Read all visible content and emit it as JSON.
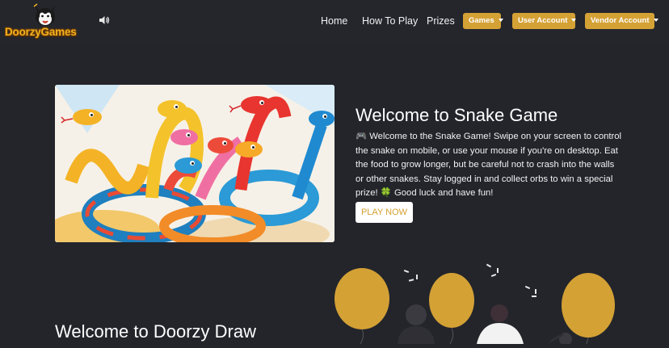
{
  "header": {
    "logo_text": "DoorzyGames",
    "nav": {
      "home": "Home",
      "how_to_play": "How To Play",
      "prizes": "Prizes"
    },
    "dropdowns": {
      "games": "Games",
      "user_account": "User Account",
      "vendor_account": "Vendor Account"
    },
    "icons": {
      "logo": "cat-mascot-icon",
      "sound": "speaker-icon",
      "caret": "caret-down-icon"
    }
  },
  "hero": {
    "image_alt": "snakes-illustration",
    "title": "Welcome to Snake Game",
    "description": "🎮 Welcome to the Snake Game! Swipe on your screen to control the snake on mobile, or use your mouse if you're on desktop. Eat the food to grow longer, but be careful not to crash into the walls or other snakes. Stay logged in and collect orbs to win a special prize! 🍀 Good luck and have fun!",
    "play_button": "PLAY NOW"
  },
  "section2": {
    "title": "Welcome to Doorzy Draw",
    "image_alt": "party-balloons-illustration"
  },
  "colors": {
    "background": "#23252b",
    "accent": "#d4a135",
    "text": "#ffffff"
  }
}
